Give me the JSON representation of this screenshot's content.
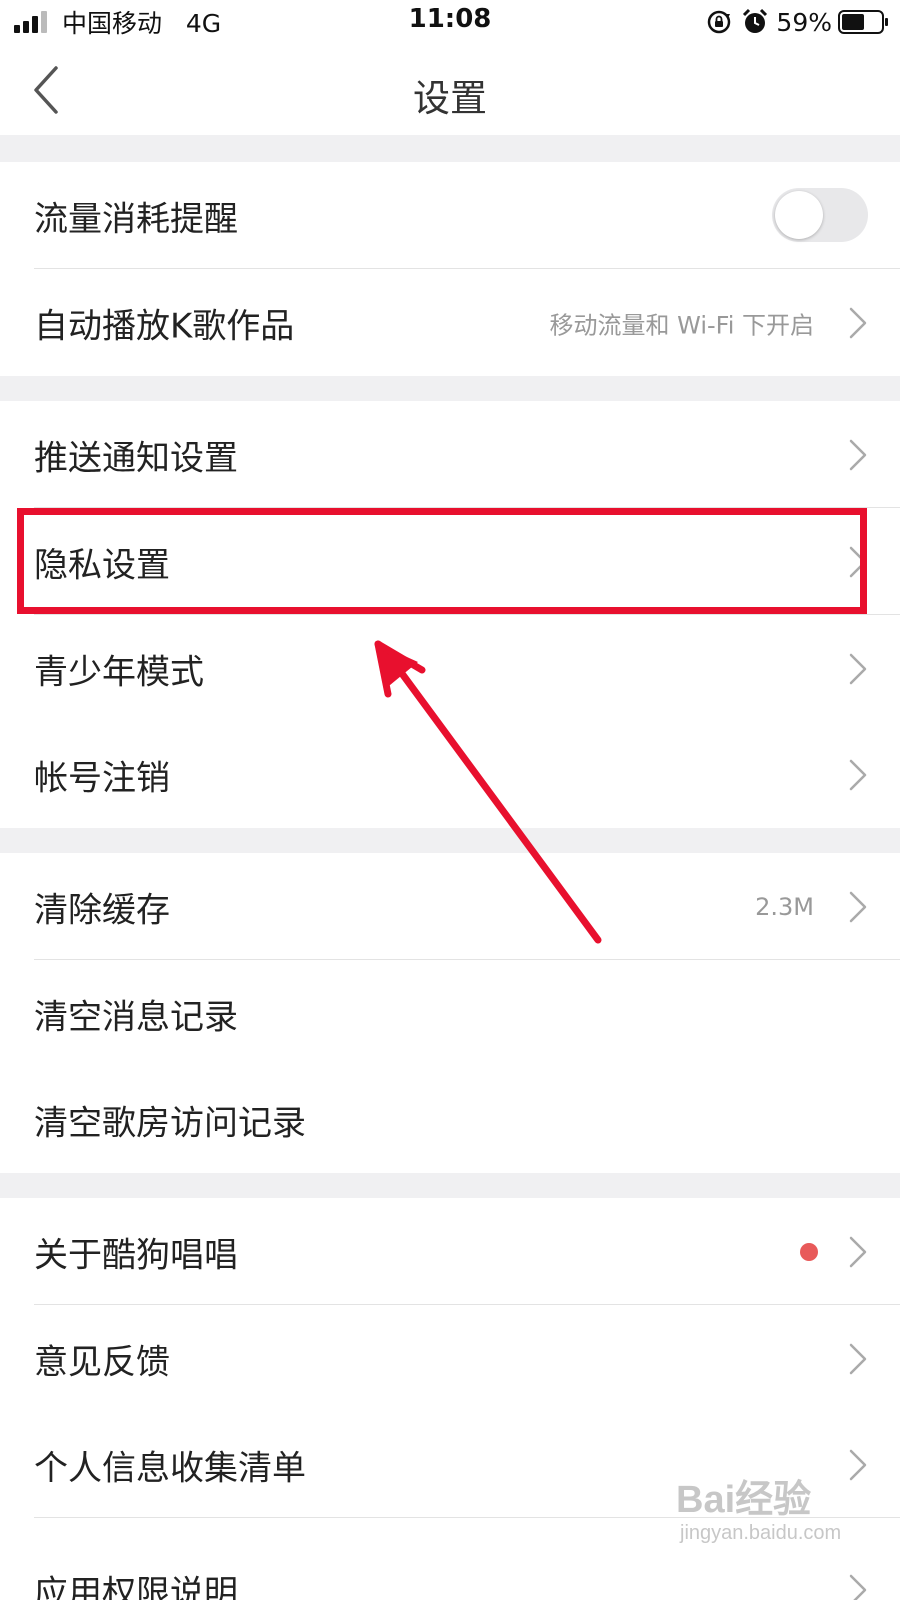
{
  "status_bar": {
    "carrier": "中国移动",
    "network": "4G",
    "time": "11:08",
    "battery_percent": "59%",
    "battery_level": 0.59
  },
  "nav": {
    "title": "设置"
  },
  "groups": [
    {
      "items": [
        {
          "label": "流量消耗提醒",
          "control": "toggle",
          "toggle_on": false
        },
        {
          "label": "自动播放K歌作品",
          "value": "移动流量和 Wi-Fi 下开启",
          "control": "chevron"
        }
      ]
    },
    {
      "items": [
        {
          "label": "推送通知设置",
          "control": "chevron"
        },
        {
          "label": "隐私设置",
          "control": "chevron",
          "highlighted": true
        },
        {
          "label": "青少年模式",
          "control": "chevron"
        },
        {
          "label": "帐号注销",
          "control": "chevron"
        }
      ]
    },
    {
      "items": [
        {
          "label": "清除缓存",
          "value": "2.3M",
          "control": "chevron"
        },
        {
          "label": "清空消息记录",
          "control": "none"
        },
        {
          "label": "清空歌房访问记录",
          "control": "none"
        }
      ]
    },
    {
      "items": [
        {
          "label": "关于酷狗唱唱",
          "control": "chevron",
          "badge": "red-dot"
        },
        {
          "label": "意见反馈",
          "control": "chevron"
        },
        {
          "label": "个人信息收集清单",
          "control": "chevron"
        },
        {
          "label": "应用权限说明",
          "control": "chevron"
        }
      ]
    }
  ],
  "colors": {
    "highlight": "#e8102e",
    "badge": "#e85a5a",
    "section_gap": "#f0f0f2",
    "secondary_text": "#999999"
  },
  "watermark": {
    "brand": "Bai经验",
    "url": "jingyan.baidu.com"
  }
}
